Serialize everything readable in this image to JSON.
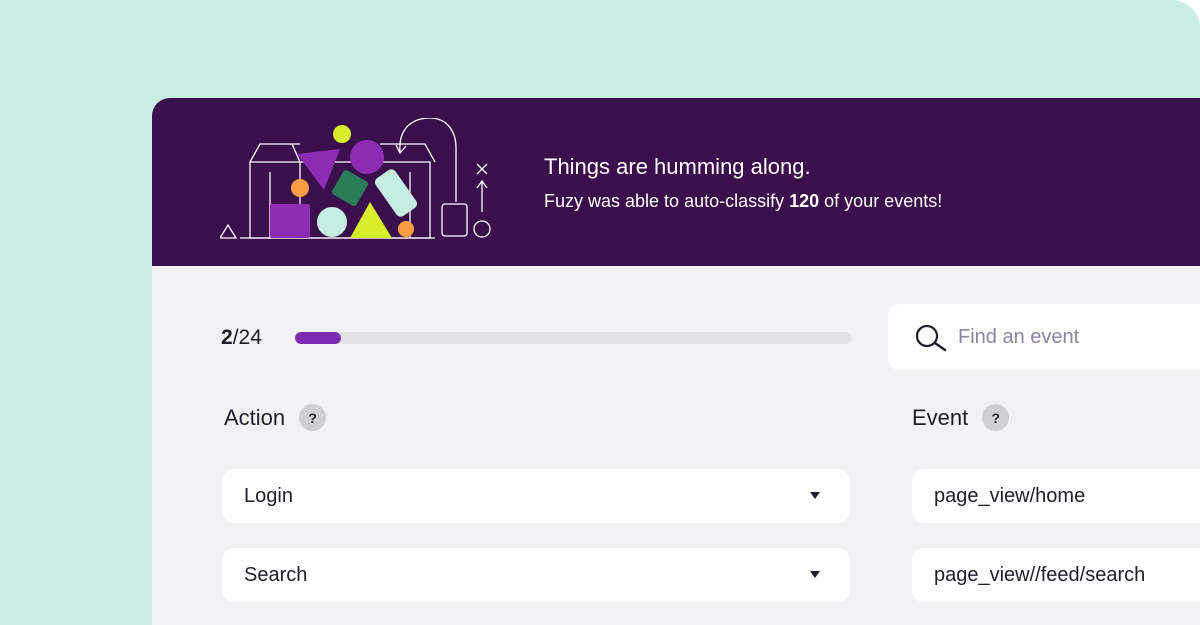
{
  "banner": {
    "title": "Things are humming along.",
    "sub_prefix": "Fuzy was able to auto-classify ",
    "sub_count": "120",
    "sub_suffix": " of your events!"
  },
  "progress": {
    "current": "2",
    "separator": "/",
    "total": "24",
    "fraction": 0.0833
  },
  "search": {
    "placeholder": "Find an event",
    "icon": "search-icon"
  },
  "columns": {
    "action_header": "Action",
    "event_header": "Event",
    "help_glyph": "?"
  },
  "rows": [
    {
      "action": "Login",
      "event": "page_view/home"
    },
    {
      "action": "Search",
      "event": "page_view//feed/search"
    }
  ],
  "colors": {
    "background": "#c9ede3",
    "banner": "#3a0f4c",
    "accent": "#7b2bb0",
    "panel": "#f2f2f4"
  }
}
